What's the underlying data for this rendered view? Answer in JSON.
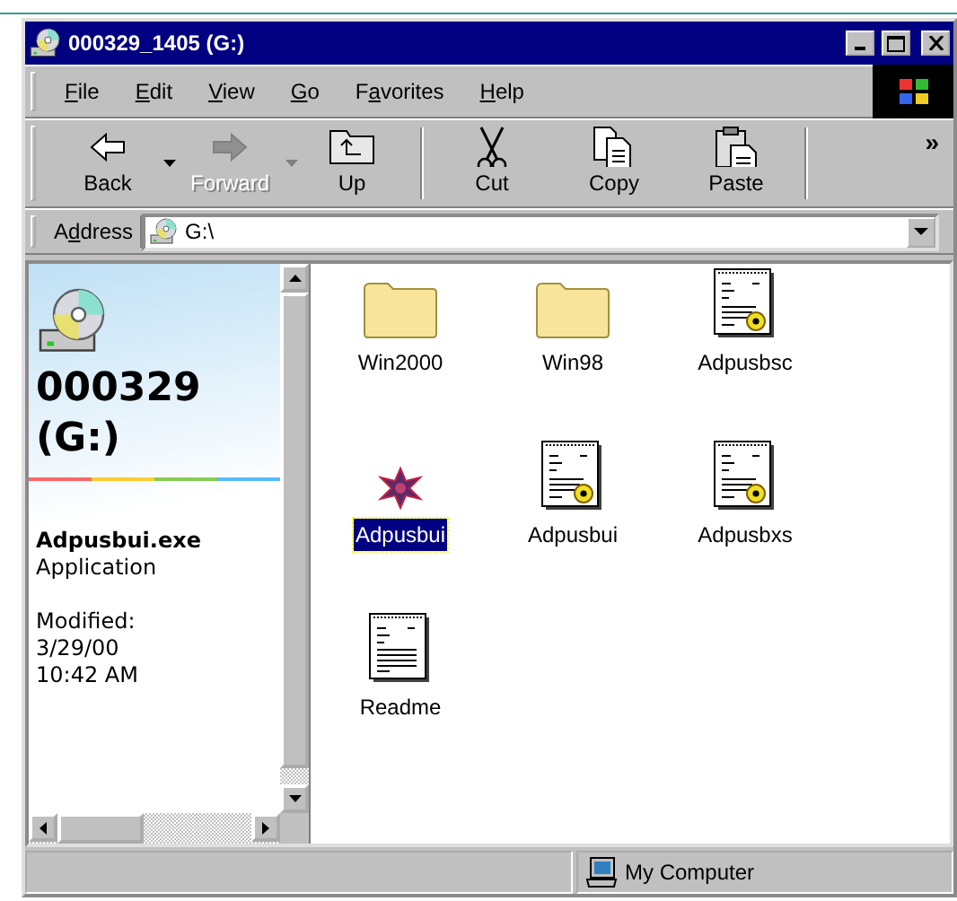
{
  "window": {
    "title": "000329_1405 (G:)"
  },
  "menu": [
    {
      "key": "F",
      "after": "ile"
    },
    {
      "key": "E",
      "after": "dit"
    },
    {
      "key": "V",
      "after": "iew"
    },
    {
      "key": "G",
      "after": "o"
    },
    {
      "before": "F",
      "key": "a",
      "after": "vorites"
    },
    {
      "key": "H",
      "after": "elp"
    }
  ],
  "toolbar": [
    {
      "kind": "back",
      "label": "Back",
      "disabled": false,
      "dropdown": true
    },
    {
      "kind": "forward",
      "label": "Forward",
      "disabled": true,
      "dropdown": true
    },
    {
      "kind": "up",
      "label": "Up",
      "disabled": false,
      "dropdown": false
    },
    {
      "kind": "separator"
    },
    {
      "kind": "cut",
      "label": "Cut",
      "disabled": false,
      "dropdown": false
    },
    {
      "kind": "copy",
      "label": "Copy",
      "disabled": false,
      "dropdown": false
    },
    {
      "kind": "paste",
      "label": "Paste",
      "disabled": false,
      "dropdown": false
    },
    {
      "kind": "separator"
    },
    {
      "kind": "chevron",
      "label": "»"
    }
  ],
  "address": {
    "label": {
      "before": "A",
      "key": "d",
      "after": "dress"
    },
    "value": "G:\\"
  },
  "info_panel": {
    "title": "000329 (G:)",
    "file_name": "Adpusbui.exe",
    "file_type": "Application",
    "modified_label": "Modified:",
    "modified_date": "3/29/00",
    "modified_time": "10:42 AM"
  },
  "files": [
    {
      "name": "Win2000",
      "kind": "folder",
      "selected": false
    },
    {
      "name": "Win98",
      "kind": "folder",
      "selected": false
    },
    {
      "name": "Adpusbsc",
      "kind": "setup",
      "selected": false
    },
    {
      "name": "Adpusbui",
      "kind": "app",
      "selected": true
    },
    {
      "name": "Adpusbui",
      "kind": "setup",
      "selected": false
    },
    {
      "name": "Adpusbxs",
      "kind": "setup",
      "selected": false
    },
    {
      "name": "Readme",
      "kind": "text",
      "selected": false
    }
  ],
  "status_bar": {
    "zone": "My Computer"
  }
}
